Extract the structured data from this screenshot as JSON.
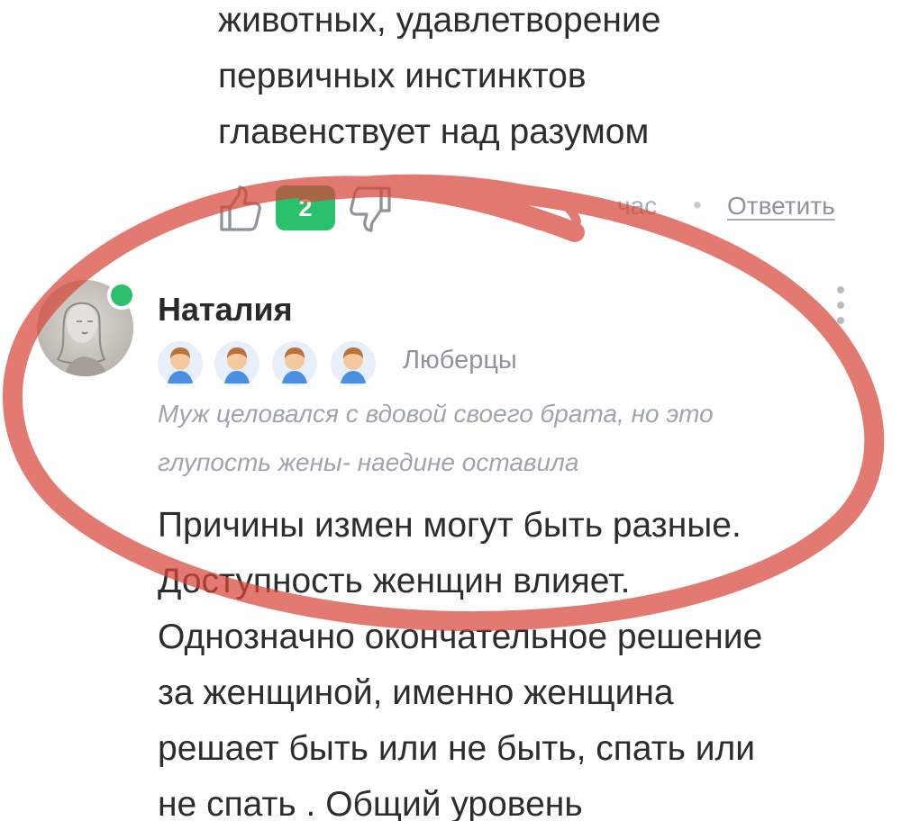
{
  "previous_comment": {
    "text_lines": [
      "животных, удавлетворение",
      "первичных инстинктов",
      "главенствует над разумом"
    ],
    "score": "2",
    "time": "час",
    "separator": "•",
    "reply_label": "Ответить",
    "colors": {
      "score_badge": "#2bc06c"
    }
  },
  "comment": {
    "author": "Наталия",
    "online": true,
    "city": "Люберцы",
    "badges": [
      "user-badge-icon",
      "user-badge-icon",
      "user-badge-icon",
      "user-badge-icon"
    ],
    "status_lines": [
      "Муж целовался с вдовой своего брата, но это",
      "глупость жены- наедине оставила"
    ],
    "text_lines": [
      "Причины измен могут быть разные.",
      "Доступность женщин влияет.",
      "Однозначно окончательное решение",
      "за женщиной, именно женщина",
      "решает быть или не быть, спать или",
      "не спать . Общий уровень"
    ],
    "colors": {
      "online_dot": "#2bc06c",
      "annotation_circle": "#d7463a"
    }
  }
}
